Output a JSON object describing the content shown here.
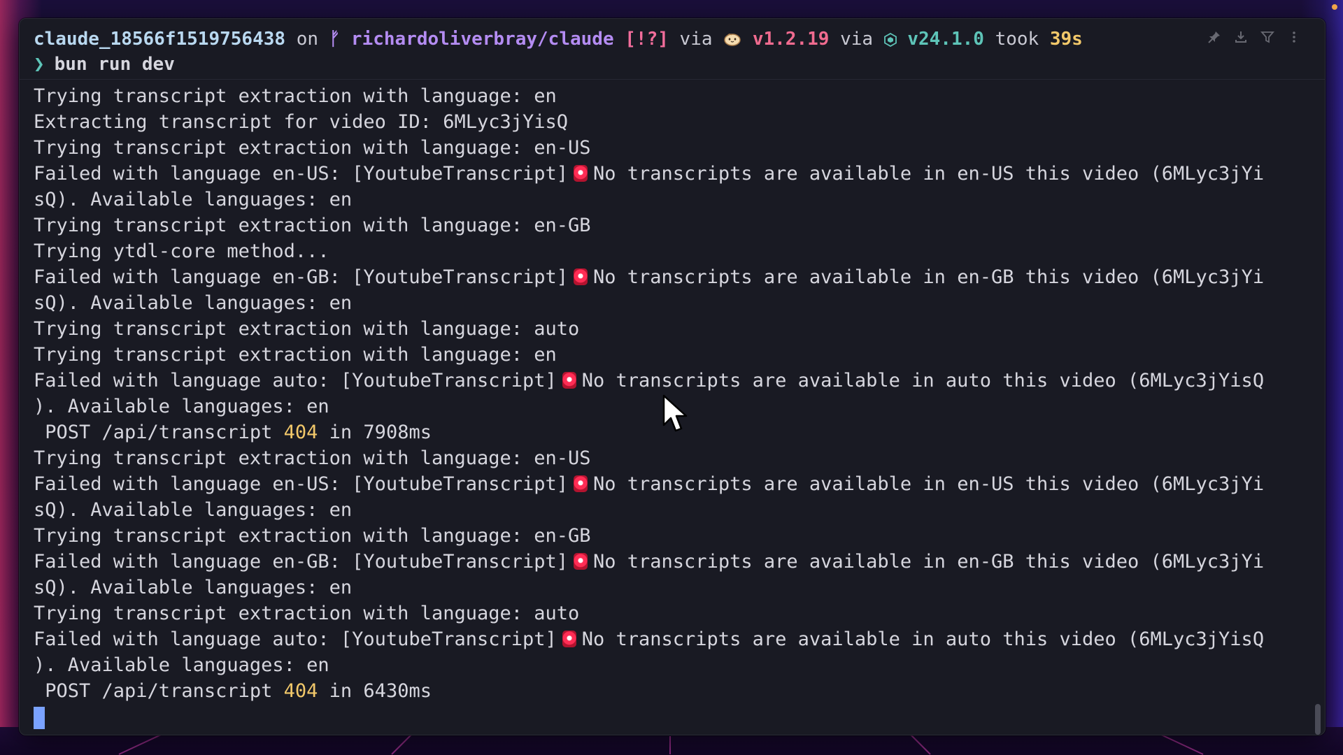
{
  "prompt": {
    "user_host": "claude_18566f1519756438",
    "on_word": "on",
    "branch_glyph": "ᚠ",
    "repo": "richardoliverbray/claude",
    "git_status": "[!?]",
    "via_word": "via",
    "bun_version": "v1.2.19",
    "node_version": "v24.1.0",
    "took_word": "took",
    "duration": "39s",
    "chevron": "❯",
    "command": "bun run dev"
  },
  "toolbar": {
    "icons": [
      "pin-icon",
      "download-icon",
      "filter-icon",
      "more-vertical-icon"
    ]
  },
  "output_lines": [
    {
      "text": "Trying transcript extraction with language: en"
    },
    {
      "text": "Extracting transcript for video ID: 6MLyc3jYisQ"
    },
    {
      "text": "Trying transcript extraction with language: en-US"
    },
    {
      "pre": "Failed with language en-US: [YoutubeTranscript]",
      "post": "No transcripts are available in en-US this video (6MLyc3jYi"
    },
    {
      "text": "sQ). Available languages: en"
    },
    {
      "text": "Trying transcript extraction with language: en-GB"
    },
    {
      "text": "Trying ytdl-core method..."
    },
    {
      "pre": "Failed with language en-GB: [YoutubeTranscript]",
      "post": "No transcripts are available in en-GB this video (6MLyc3jYi"
    },
    {
      "text": "sQ). Available languages: en"
    },
    {
      "text": "Trying transcript extraction with language: auto"
    },
    {
      "text": "Trying transcript extraction with language: en"
    },
    {
      "pre": "Failed with language auto: [YoutubeTranscript]",
      "post": "No transcripts are available in auto this video (6MLyc3jYisQ"
    },
    {
      "text": "). Available languages: en"
    },
    {
      "req_pre": " POST /api/transcript ",
      "status": "404",
      "req_post": " in 7908ms"
    },
    {
      "text": "Trying transcript extraction with language: en-US"
    },
    {
      "pre": "Failed with language en-US: [YoutubeTranscript]",
      "post": "No transcripts are available in en-US this video (6MLyc3jYi"
    },
    {
      "text": "sQ). Available languages: en"
    },
    {
      "text": "Trying transcript extraction with language: en-GB"
    },
    {
      "pre": "Failed with language en-GB: [YoutubeTranscript]",
      "post": "No transcripts are available in en-GB this video (6MLyc3jYi"
    },
    {
      "text": "sQ). Available languages: en"
    },
    {
      "text": "Trying transcript extraction with language: auto"
    },
    {
      "pre": "Failed with language auto: [YoutubeTranscript]",
      "post": "No transcripts are available in auto this video (6MLyc3jYisQ"
    },
    {
      "text": "). Available languages: en"
    },
    {
      "req_pre": " POST /api/transcript ",
      "status": "404",
      "req_post": " in 6430ms"
    }
  ],
  "colors": {
    "terminal_bg": "#191a23",
    "text": "#d6d6de",
    "status_404": "#f2c86a",
    "cursor": "#7aa2ff"
  }
}
